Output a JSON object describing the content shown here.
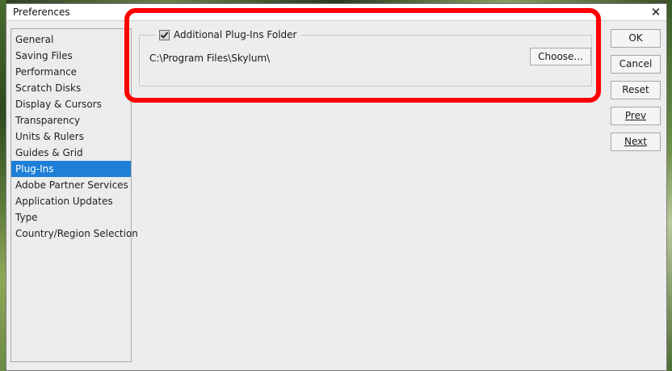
{
  "window": {
    "title": "Preferences",
    "close_glyph": "✕"
  },
  "categories": [
    {
      "label": "General"
    },
    {
      "label": "Saving Files"
    },
    {
      "label": "Performance"
    },
    {
      "label": "Scratch Disks"
    },
    {
      "label": "Display & Cursors"
    },
    {
      "label": "Transparency"
    },
    {
      "label": "Units & Rulers"
    },
    {
      "label": "Guides & Grid"
    },
    {
      "label": "Plug-Ins",
      "selected": true
    },
    {
      "label": "Adobe Partner Services"
    },
    {
      "label": "Application Updates"
    },
    {
      "label": "Type"
    },
    {
      "label": "Country/Region Selection"
    }
  ],
  "plugins": {
    "additional_folder_label": "Additional Plug-Ins Folder",
    "additional_folder_checked": true,
    "folder_path": "C:\\Program Files\\Skylum\\",
    "choose_label": "Choose..."
  },
  "buttons": {
    "ok": "OK",
    "cancel": "Cancel",
    "reset": "Reset",
    "prev": "Prev",
    "next": "Next"
  },
  "colors": {
    "selection": "#1e7fd8",
    "highlight": "#ff0000"
  }
}
